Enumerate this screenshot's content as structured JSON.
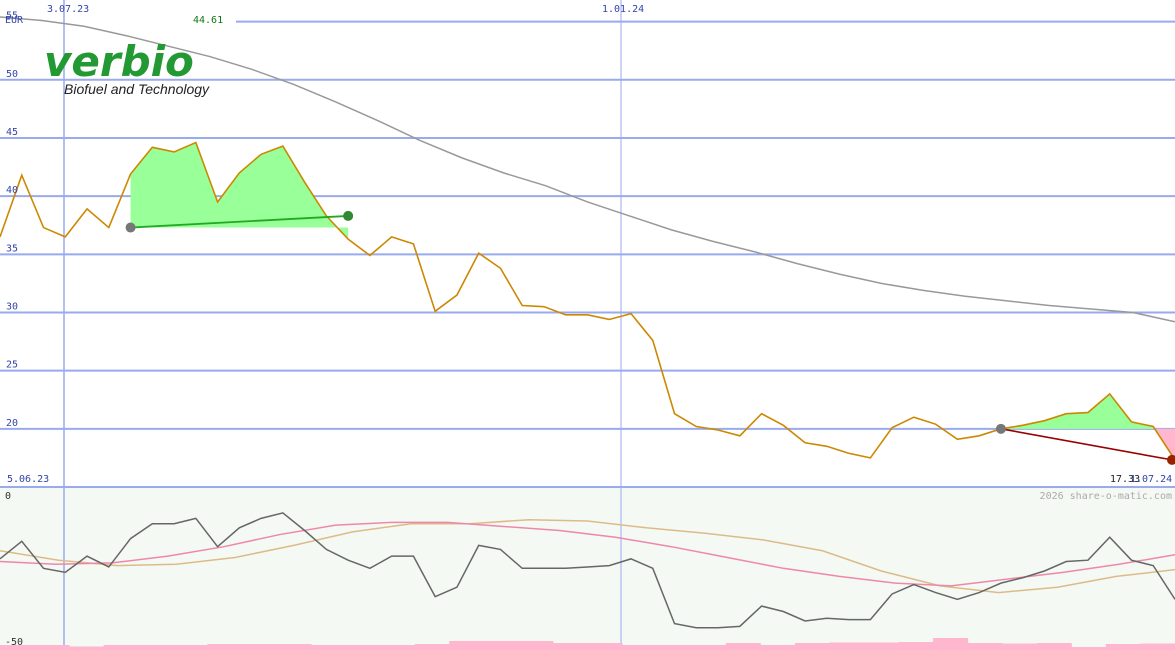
{
  "chart_data": [
    {
      "type": "line",
      "title": "",
      "currency": "EUR",
      "ylim": [
        15,
        56
      ],
      "y_ticks": [
        "55",
        "50",
        "45",
        "40",
        "35",
        "30",
        "25",
        "20"
      ],
      "x_marks": [
        "3.07.23",
        "1.01.24"
      ],
      "start_date": "5.06.23",
      "end_date": "1.07.24",
      "high_label": "44.61",
      "low_label": "17.33",
      "watermark": "2026 share-o-matic.com",
      "grid": true,
      "series": [
        {
          "role": "price",
          "color": "#cc8800",
          "values": [
            36.5,
            41.8,
            37.3,
            36.5,
            38.9,
            37.3,
            41.9,
            44.2,
            43.8,
            44.61,
            39.5,
            42,
            43.6,
            44.3,
            41.2,
            38.3,
            36.3,
            34.9,
            36.5,
            35.9,
            30.1,
            31.5,
            35.1,
            33.8,
            30.6,
            30.5,
            29.8,
            29.8,
            29.4,
            29.9,
            27.6,
            21.3,
            20.2,
            19.9,
            19.4,
            21.3,
            20.3,
            18.8,
            18.5,
            17.9,
            17.5,
            20.1,
            21,
            20.4,
            19.1,
            19.4,
            20,
            20.3,
            20.7,
            21.3,
            21.4,
            23,
            20.6,
            20.2,
            17.33
          ]
        },
        {
          "role": "moving-average",
          "color": "#999999",
          "values": [
            55.4,
            55.1,
            54.6,
            53.8,
            52.9,
            52,
            50.9,
            49.6,
            48.1,
            46.5,
            44.8,
            43.3,
            42,
            40.9,
            39.5,
            38.3,
            37.1,
            36.1,
            35.2,
            34.2,
            33.3,
            32.5,
            31.9,
            31.4,
            31,
            30.6,
            30.3,
            30,
            29.2
          ]
        }
      ],
      "highlights": [
        {
          "start_value": 37.3,
          "end_value": 38.3,
          "trend": "up",
          "line_color": "#22aa22",
          "fill_color": "#99ff99"
        },
        {
          "start_value": 20,
          "end_value": 17.33,
          "trend": "down",
          "line_color": "#990000",
          "fill_color": "#ffb6cf"
        }
      ]
    },
    {
      "type": "line",
      "title": "",
      "ylim": [
        -50,
        0
      ],
      "y_ticks": [
        "0",
        "-50"
      ],
      "series": [
        {
          "role": "oscillator",
          "color": "#666666",
          "values": [
            -15.5,
            -9,
            -19,
            -20.5,
            -14.5,
            -18.5,
            -8,
            -2.5,
            -2.5,
            -0.5,
            -11,
            -4,
            -0.5,
            1.5,
            -5,
            -12,
            -16,
            -19,
            -14.5,
            -14.5,
            -29.5,
            -26,
            -10.5,
            -12,
            -19,
            -19,
            -19,
            -18.5,
            -18,
            -15.5,
            -19,
            -39.5,
            -41,
            -41,
            -40.5,
            -33,
            -35,
            -38.5,
            -37.5,
            -38,
            -38,
            -28.5,
            -25,
            -28,
            -30.5,
            -28,
            -24.5,
            -22.5,
            -20,
            -16.5,
            -16,
            -7.5,
            -16,
            -18,
            -30.5
          ]
        },
        {
          "role": "signal-pink",
          "color": "#ee88aa",
          "values": [
            -16.5,
            -17.5,
            -17,
            -14.5,
            -11,
            -6.5,
            -3,
            -2,
            -2,
            -3.5,
            -5,
            -7.5,
            -11,
            -15,
            -19,
            -22,
            -24.5,
            -25.5,
            -23,
            -20.5,
            -17.5,
            -14
          ]
        },
        {
          "role": "signal-tan",
          "color": "#ddbb88",
          "values": [
            -12.5,
            -16,
            -18,
            -17.5,
            -15,
            -10.5,
            -5.5,
            -2.5,
            -2.5,
            -1,
            -1.5,
            -4,
            -6,
            -8.5,
            -12.5,
            -20,
            -25.5,
            -28,
            -26,
            -22,
            -19.5
          ]
        }
      ],
      "volume": [
        1,
        1,
        0.7,
        1,
        1,
        1,
        1.2,
        1.2,
        1.2,
        1,
        1,
        1,
        1.2,
        1.8,
        1.8,
        1.8,
        1.4,
        1.4,
        1,
        1,
        1,
        1.4,
        1,
        1.4,
        1.5,
        1.5,
        1.6,
        2.4,
        1.4,
        1.3,
        1.4,
        0.6,
        1.2,
        1.3
      ]
    }
  ],
  "logo": {
    "wordmark": "verbio",
    "tagline": "Biofuel and Technology",
    "color": "#229933",
    "tagline_color": "#222222"
  },
  "colors": {
    "grid": "#99aaee",
    "tick_label": "#3344aa",
    "high_label": "#117711",
    "low_label": "#222222",
    "watermark": "#aaaaaa",
    "background_top": "#ffffff",
    "background_bottom": "#f4f9f4",
    "volume": "#ffb6cf",
    "marker_gray": "#777777"
  }
}
